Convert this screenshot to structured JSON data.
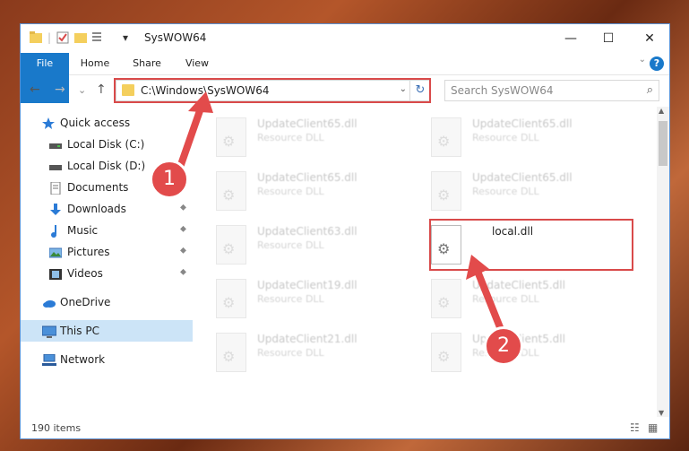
{
  "titlebar": {
    "title": "SysWOW64",
    "qa_separator": "|",
    "qa_dropdown": "▾",
    "minimize": "—",
    "maximize": "☐",
    "close": "✕"
  },
  "ribbon": {
    "tabs": [
      "File",
      "Home",
      "Share",
      "View"
    ],
    "help": "?",
    "expand": "⌄"
  },
  "nav": {
    "back": "←",
    "forward": "→",
    "recent": "⌄",
    "up": "↑"
  },
  "address": {
    "path": "C:\\Windows\\SysWOW64",
    "dropdown": "⌄",
    "refresh": "↻"
  },
  "search": {
    "placeholder": "Search SysWOW64",
    "icon": "⌕"
  },
  "sidebar": {
    "items": [
      {
        "label": "Quick access",
        "icon": "star-icon"
      },
      {
        "label": "Local Disk (C:)",
        "icon": "drive-icon"
      },
      {
        "label": "Local Disk (D:)",
        "icon": "drive-icon"
      },
      {
        "label": "Documents",
        "icon": "documents-icon"
      },
      {
        "label": "Downloads",
        "icon": "download-icon"
      },
      {
        "label": "Music",
        "icon": "music-icon"
      },
      {
        "label": "Pictures",
        "icon": "pictures-icon"
      },
      {
        "label": "Videos",
        "icon": "videos-icon"
      },
      {
        "label": "OneDrive",
        "icon": "cloud-icon"
      },
      {
        "label": "This PC",
        "icon": "computer-icon"
      },
      {
        "label": "Network",
        "icon": "network-icon"
      }
    ],
    "pin": "⬥"
  },
  "files": [
    {
      "name": "UpdateClient65.dll",
      "type": "Resource DLL"
    },
    {
      "name": "UpdateClient65.dll",
      "type": "Resource DLL"
    },
    {
      "name": "UpdateClient65.dll",
      "type": "Resource DLL"
    },
    {
      "name": "UpdateClient65.dll",
      "type": "Resource DLL"
    },
    {
      "name": "UpdateClient63.dll",
      "type": "Resource DLL"
    },
    {
      "name": "local.dll",
      "type": ""
    },
    {
      "name": "UpdateClient19.dll",
      "type": "Resource DLL"
    },
    {
      "name": "UpdateClient5.dll",
      "type": "Resource DLL"
    },
    {
      "name": "UpdateClient21.dll",
      "type": "Resource DLL"
    },
    {
      "name": "UpdateClient5.dll",
      "type": "Resource DLL"
    }
  ],
  "status": {
    "count": "190 items",
    "details_view": "☷",
    "icons_view": "▦"
  },
  "scroll": {
    "up": "▲",
    "down": "▼"
  },
  "annotations": {
    "step1": "1",
    "step2": "2"
  },
  "colors": {
    "accent": "#1979ca",
    "highlight": "#d94a4a",
    "selection": "#cce4f7"
  }
}
